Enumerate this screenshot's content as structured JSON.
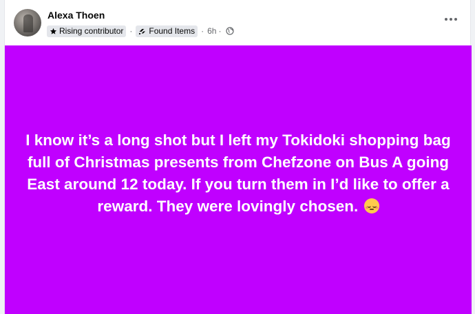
{
  "post": {
    "author": "Alexa Thoen",
    "badges": {
      "contributor": "Rising contributor",
      "group": "Found Items"
    },
    "separator": "·",
    "time": "6h",
    "time_sep": "·",
    "body_text": "I know it’s a long shot but I left my Tokidoki shopping bag full of Christmas presents from Chefzone on Bus A going East around 12 today. If you turn them in I’d like to offer a reward. They were lovingly chosen.",
    "emoji": "pensive-face",
    "background_color": "#c000ff"
  },
  "icons": {
    "more": "more-options-icon",
    "globe": "globe-icon",
    "star": "star-icon",
    "tag": "tag-icon"
  }
}
